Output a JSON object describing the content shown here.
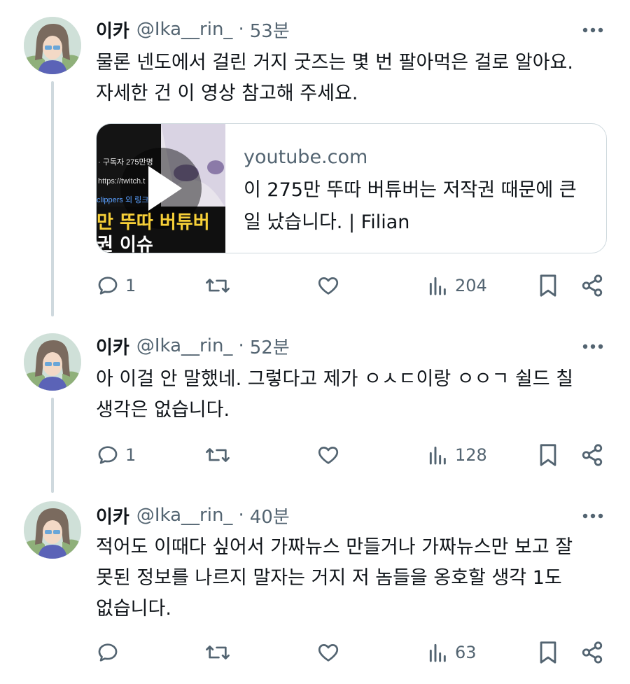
{
  "colors": {
    "text": "#0f1419",
    "secondary": "#536471",
    "border": "#cfd9de"
  },
  "tweets": [
    {
      "name": "이카",
      "handle": "@Ika__rin_",
      "separator": "·",
      "time": "53분",
      "text": "물론 넨도에서 걸린 거지 굿즈는 몇 번 팔아먹은 걸로 알아요.\n자세한 건 이 영상 참고해 주세요.",
      "card": {
        "domain": "youtube.com",
        "title": "이 275만 뚜따 버튜버는 저작권 때문에 큰일 났습니다. | Filian",
        "thumb_lines": [
          "· 구독자 275만명",
          "https://twitch.t",
          "clippers 외 링크",
          "만 뚜따 버튜버",
          "권 이슈"
        ]
      },
      "replies": "1",
      "views": "204"
    },
    {
      "name": "이카",
      "handle": "@Ika__rin_",
      "separator": "·",
      "time": "52분",
      "text": "아 이걸 안 말했네. 그렇다고 제가 ㅇㅅㄷ이랑 ㅇㅇㄱ 쉴드 칠\n생각은 없습니다.",
      "replies": "1",
      "views": "128"
    },
    {
      "name": "이카",
      "handle": "@Ika__rin_",
      "separator": "·",
      "time": "40분",
      "text": "적어도 이때다 싶어서 가짜뉴스 만들거나 가짜뉴스만 보고 잘\n못된 정보를 나르지 말자는 거지 저 놈들을 옹호할 생각 1도\n없습니다.",
      "replies": "",
      "views": "63"
    }
  ]
}
